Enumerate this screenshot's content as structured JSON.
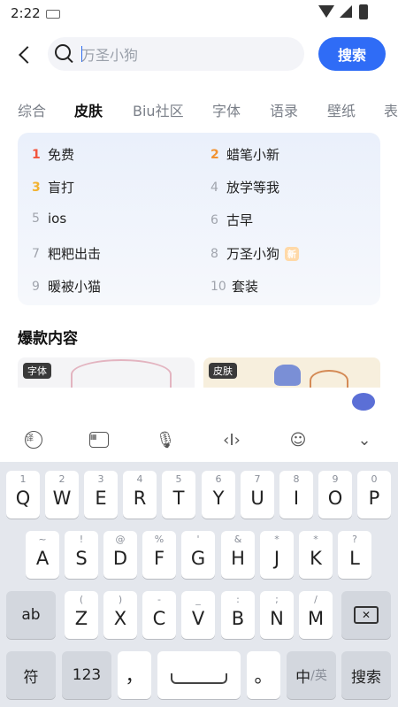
{
  "status": {
    "time": "2:22"
  },
  "search": {
    "value": "万圣小狗",
    "button": "搜索"
  },
  "tabs": [
    "综合",
    "皮肤",
    "Biu社区",
    "字体",
    "语录",
    "壁纸",
    "表"
  ],
  "hot_list": [
    {
      "rank": "1",
      "text": "免费"
    },
    {
      "rank": "2",
      "text": "蜡笔小新"
    },
    {
      "rank": "3",
      "text": "盲打"
    },
    {
      "rank": "4",
      "text": "放学等我"
    },
    {
      "rank": "5",
      "text": "ios"
    },
    {
      "rank": "6",
      "text": "古早"
    },
    {
      "rank": "7",
      "text": "粑粑出击"
    },
    {
      "rank": "8",
      "text": "万圣小狗",
      "badge": "新"
    },
    {
      "rank": "9",
      "text": "暖被小猫"
    },
    {
      "rank": "10",
      "text": "套装"
    }
  ],
  "section": {
    "title": "爆款内容"
  },
  "cards": [
    {
      "tag": "字体"
    },
    {
      "tag": "皮肤"
    }
  ],
  "kb_toolbar": {
    "icons": [
      "voice-translate-icon",
      "keyboard-icon",
      "microphone-icon",
      "cursor-move-icon",
      "emoji-icon",
      "collapse-icon"
    ]
  },
  "keyboard": {
    "row1": [
      {
        "sub": "1",
        "key": "Q"
      },
      {
        "sub": "2",
        "key": "W"
      },
      {
        "sub": "3",
        "key": "E"
      },
      {
        "sub": "4",
        "key": "R"
      },
      {
        "sub": "5",
        "key": "T"
      },
      {
        "sub": "6",
        "key": "Y"
      },
      {
        "sub": "7",
        "key": "U"
      },
      {
        "sub": "8",
        "key": "I"
      },
      {
        "sub": "9",
        "key": "O"
      },
      {
        "sub": "0",
        "key": "P"
      }
    ],
    "row2": [
      {
        "sub": "~",
        "key": "A"
      },
      {
        "sub": "!",
        "key": "S"
      },
      {
        "sub": "@",
        "key": "D"
      },
      {
        "sub": "%",
        "key": "F"
      },
      {
        "sub": "'",
        "key": "G"
      },
      {
        "sub": "&",
        "key": "H"
      },
      {
        "sub": "*",
        "key": "J"
      },
      {
        "sub": "*",
        "key": "K"
      },
      {
        "sub": "?",
        "key": "L"
      }
    ],
    "row3_left": "ab",
    "row3": [
      {
        "sub": "(",
        "key": "Z"
      },
      {
        "sub": ")",
        "key": "X"
      },
      {
        "sub": "-",
        "key": "C"
      },
      {
        "sub": "_",
        "key": "V"
      },
      {
        "sub": ":",
        "key": "B"
      },
      {
        "sub": ";",
        "key": "N"
      },
      {
        "sub": "/",
        "key": "M"
      }
    ],
    "row4": {
      "symbol": "符",
      "num": "123",
      "comma": "，",
      "period": "。",
      "lang_main": "中",
      "lang_alt": "/英",
      "enter": "搜索"
    }
  }
}
